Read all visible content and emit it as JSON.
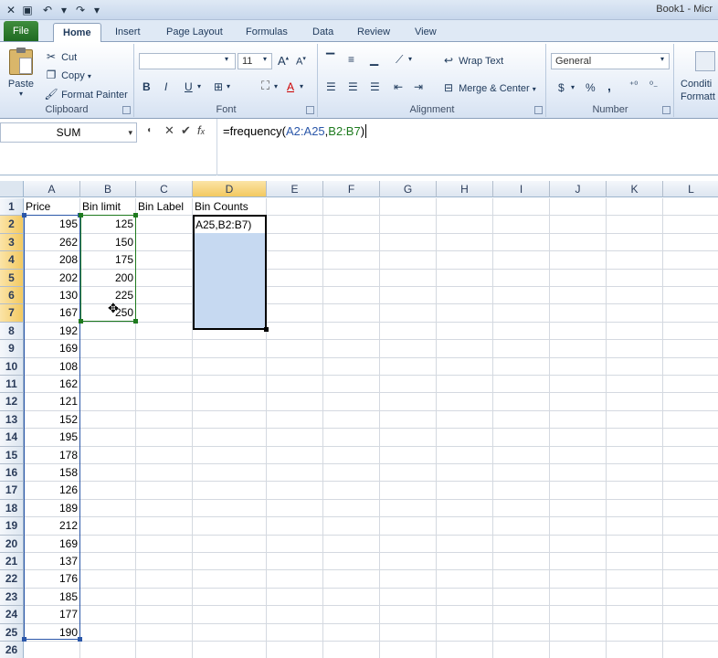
{
  "window": {
    "title": "Book1 - Micr"
  },
  "tabs": [
    "File",
    "Home",
    "Insert",
    "Page Layout",
    "Formulas",
    "Data",
    "Review",
    "View"
  ],
  "active_tab": "Home",
  "ribbon": {
    "clipboard": {
      "label": "Clipboard",
      "paste": "Paste",
      "cut": "Cut",
      "copy": "Copy",
      "format_painter": "Format Painter"
    },
    "font": {
      "label": "Font",
      "font_name": "",
      "font_size": "11",
      "bold": "B",
      "italic": "I",
      "underline": "U"
    },
    "alignment": {
      "label": "Alignment",
      "wrap_text": "Wrap Text",
      "merge_center": "Merge & Center"
    },
    "number": {
      "label": "Number",
      "format": "General",
      "currency": "$",
      "percent": "%",
      "comma": ","
    },
    "styles": {
      "conditional_formatting": "Conditi",
      "formatting2": "Formatt"
    }
  },
  "formula_bar": {
    "name_box": "SUM",
    "formula_prefix": "=frequency(",
    "formula_ref_a": "A2:A25",
    "formula_sep": ",",
    "formula_ref_b": "B2:B7",
    "formula_suffix": ")"
  },
  "columns": [
    "A",
    "B",
    "C",
    "D",
    "E",
    "F",
    "G",
    "H",
    "I",
    "J",
    "K",
    "L"
  ],
  "rows": [
    "1",
    "2",
    "3",
    "4",
    "5",
    "6",
    "7",
    "8",
    "9",
    "10",
    "11",
    "12",
    "13",
    "14",
    "15",
    "16",
    "17",
    "18",
    "19",
    "20",
    "21",
    "22",
    "23",
    "24",
    "25",
    "26"
  ],
  "headers": {
    "A1": "Price",
    "B1": "Bin limit",
    "C1": "Bin Label",
    "D1": "Bin Counts"
  },
  "prices": [
    "195",
    "262",
    "208",
    "202",
    "130",
    "167",
    "192",
    "169",
    "108",
    "162",
    "121",
    "152",
    "195",
    "178",
    "158",
    "126",
    "189",
    "212",
    "169",
    "137",
    "176",
    "185",
    "177",
    "190"
  ],
  "bin_limits": [
    "125",
    "150",
    "175",
    "200",
    "225",
    "250"
  ],
  "d2_edit": "A25,B2:B7)"
}
